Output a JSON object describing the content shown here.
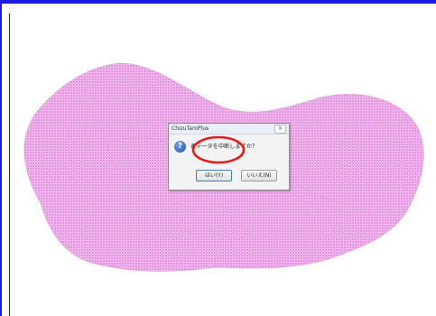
{
  "dialog": {
    "title": "ChizuTaroPlus",
    "close_label": "✕",
    "message": "表データを中断しますか？",
    "icon": "question-icon",
    "buttons": {
      "yes": "はい(Y)",
      "no": "いいえ(N)"
    }
  },
  "colors": {
    "frame": "#1c1ce0",
    "polygon_fill": "#f3b2f0",
    "polygon_dots": "#d86bd4",
    "annotation": "#e31b1b"
  }
}
